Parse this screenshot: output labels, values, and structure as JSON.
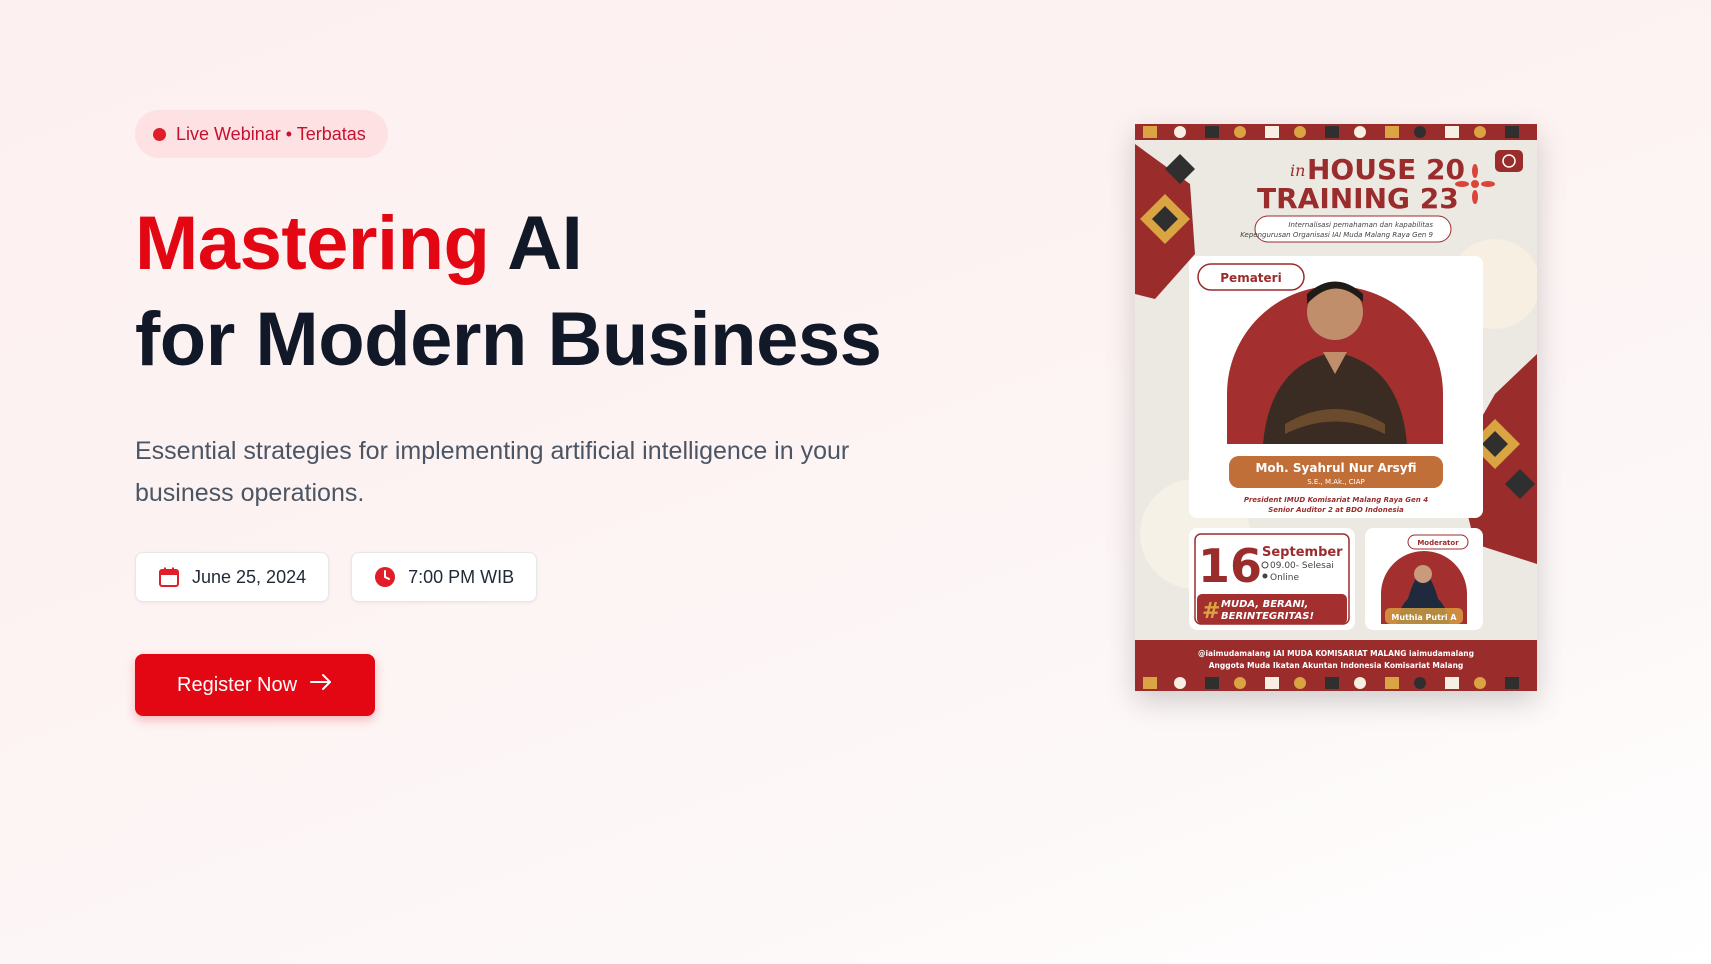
{
  "hero": {
    "badge": "Live Webinar • Terbatas",
    "title_accent": "Mastering",
    "title_rest": " AI",
    "title_line2": "for Modern Business",
    "subtitle": "Essential strategies for implementing artificial intelligence in your business operations.",
    "date": "June 25, 2024",
    "time": "7:00 PM WIB",
    "register_label": "Register Now",
    "icons": {
      "date": "calendar-icon",
      "time": "clock-icon",
      "register": "arrow-right-icon"
    },
    "colors": {
      "accent": "#e30613",
      "badge_bg": "#fde1e3",
      "badge_text": "#c8102e"
    }
  },
  "poster": {
    "title_prefix": "in",
    "title_line1": "HOUSE 20",
    "title_line2": "TRAINING 23",
    "tagline_line1": "Internalisasi pemahaman dan kapabilitas",
    "tagline_line2": "Kepengurusan Organisasi IAI Muda Malang Raya Gen 9",
    "speaker_label": "Pemateri",
    "speaker_name": "Moh. Syahrul Nur Arsyfi",
    "speaker_degree": "S.E., M.Ak., CIAP",
    "speaker_role_line1": "President IMUD Komisariat Malang Raya Gen 4",
    "speaker_role_line2": "Senior Auditor 2 at BDO Indonesia",
    "day": "16",
    "month": "September",
    "time": "09.00- Selesai",
    "mode": "Online",
    "hashtag_line1": "MUDA, BERANI,",
    "hashtag_line2": "BERINTEGRITAS!",
    "moderator_label": "Moderator",
    "moderator_name": "Muthia Putri A",
    "footer_line1": "@iaimudamalang   IAI MUDA KOMISARIAT MALANG   iaimudamalang",
    "footer_line2": "Anggota Muda Ikatan Akuntan Indonesia Komisariat Malang",
    "colors": {
      "maroon": "#9b2c2c",
      "gold": "#d9a441",
      "cream": "#f4f1ec"
    }
  }
}
